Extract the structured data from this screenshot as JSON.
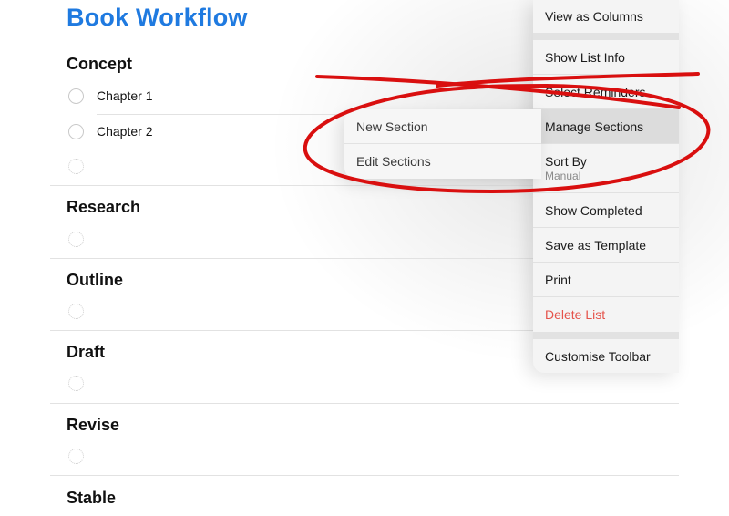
{
  "list": {
    "title": "Book Workflow",
    "title_color": "#1f7ae0",
    "sections": [
      {
        "name": "Concept",
        "items": [
          "Chapter 1",
          "Chapter 2"
        ]
      },
      {
        "name": "Research",
        "items": []
      },
      {
        "name": "Outline",
        "items": []
      },
      {
        "name": "Draft",
        "items": []
      },
      {
        "name": "Revise",
        "items": []
      },
      {
        "name": "Stable",
        "items": []
      }
    ]
  },
  "menu": {
    "items": [
      {
        "label": "View as Columns"
      },
      {
        "label": "Show List Info"
      },
      {
        "label": "Select Reminders"
      },
      {
        "label": "Manage Sections",
        "state": "highlighted"
      },
      {
        "label": "Sort By",
        "sublabel": "Manual"
      },
      {
        "label": "Show Completed"
      },
      {
        "label": "Save as Template"
      },
      {
        "label": "Print"
      },
      {
        "label": "Delete List",
        "style": "destructive",
        "color": "#e5534b"
      },
      {
        "label": "Customise Toolbar"
      }
    ]
  },
  "submenu": {
    "items": [
      {
        "label": "New Section"
      },
      {
        "label": "Edit Sections"
      }
    ]
  },
  "annotation": {
    "color": "#d90f0f",
    "shapes": [
      "cross-out-strokes",
      "circle-around-manage-sections"
    ]
  }
}
